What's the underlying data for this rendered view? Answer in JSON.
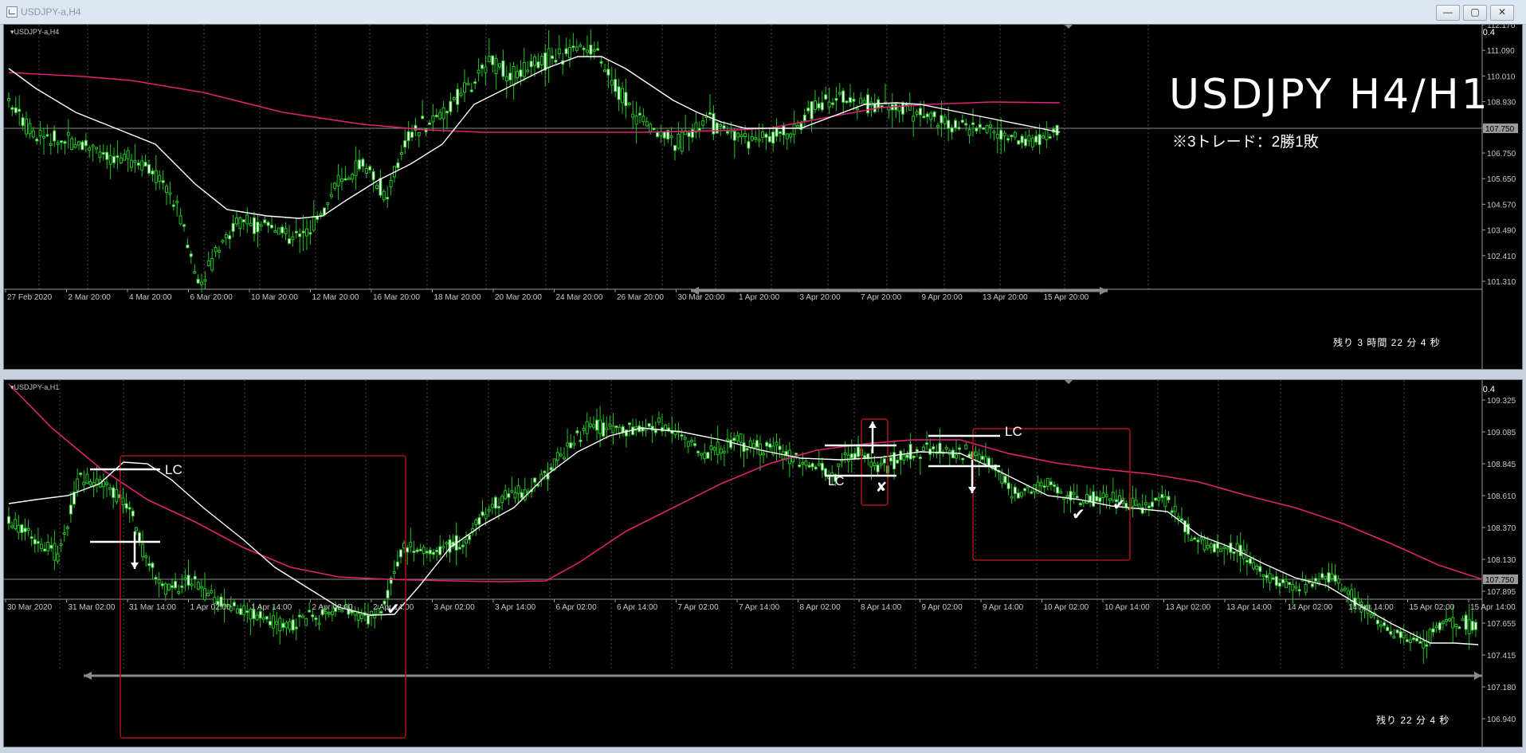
{
  "window": {
    "title": "USDJPY-a,H4",
    "buttons": [
      "—",
      "▢",
      "✕"
    ]
  },
  "top_chart": {
    "symbol_label": "USDJPY-a,H4",
    "scale_value": "0.4",
    "big_title": "USDJPY  H4/H1",
    "note": "※3トレード：2勝1敗",
    "countdown": "残り 3 時間 22 分 4 秒",
    "current_price": "107.750",
    "price_ticks": [
      "112.170",
      "111.090",
      "110.010",
      "108.930",
      "107.750",
      "106.750",
      "105.650",
      "104.570",
      "103.490",
      "102.410",
      "101.310"
    ],
    "time_ticks": [
      "27 Feb 2020",
      "2 Mar 20:00",
      "4 Mar 20:00",
      "6 Mar 20:00",
      "10 Mar 20:00",
      "12 Mar 20:00",
      "16 Mar 20:00",
      "18 Mar 20:00",
      "20 Mar 20:00",
      "24 Mar 20:00",
      "26 Mar 20:00",
      "30 Mar 20:00",
      "1 Apr 20:00",
      "3 Apr 20:00",
      "7 Apr 20:00",
      "9 Apr 20:00",
      "13 Apr 20:00",
      "15 Apr 20:00"
    ]
  },
  "bottom_chart": {
    "symbol_label": "USDJPY-a,H1",
    "scale_value": "0.4",
    "countdown": "残り 22 分 4 秒",
    "current_price": "107.750",
    "price_ticks": [
      "109.325",
      "109.085",
      "108.845",
      "108.610",
      "108.370",
      "108.130",
      "107.895",
      "107.655",
      "107.415",
      "107.180",
      "106.940"
    ],
    "time_ticks": [
      "30 Mar 2020",
      "31 Mar 02:00",
      "31 Mar 14:00",
      "1 Apr 02:00",
      "1 Apr 14:00",
      "2 Apr 02:00",
      "2 Apr 14:00",
      "3 Apr 02:00",
      "3 Apr 14:00",
      "6 Apr 02:00",
      "6 Apr 14:00",
      "7 Apr 02:00",
      "7 Apr 14:00",
      "8 Apr 02:00",
      "8 Apr 14:00",
      "9 Apr 02:00",
      "9 Apr 14:00",
      "10 Apr 02:00",
      "10 Apr 14:00",
      "13 Apr 02:00",
      "13 Apr 14:00",
      "14 Apr 02:00",
      "14 Apr 14:00",
      "15 Apr 02:00",
      "15 Apr 14:00"
    ],
    "annotations": {
      "lc_label": "LC",
      "win_mark": "✔",
      "loss_mark": "✘"
    }
  },
  "colors": {
    "candle": "#22c322",
    "sma_fast": "#ffffff",
    "sma_slow": "#e0207a",
    "trade_box": "#b01212",
    "grid": "#3a3a3a"
  }
}
